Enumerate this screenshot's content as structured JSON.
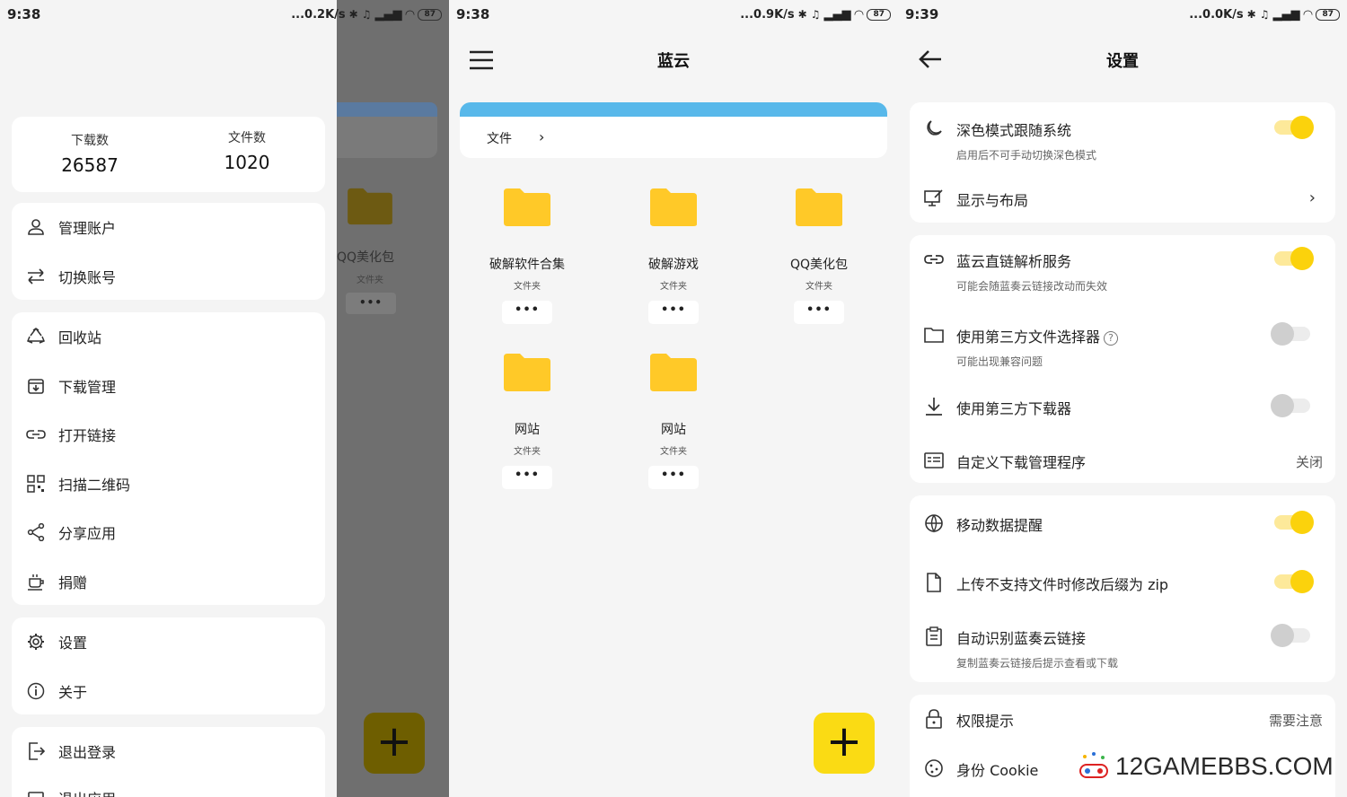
{
  "status_bars": [
    {
      "time": "9:38",
      "net": "...0.2K/s",
      "battery": "87"
    },
    {
      "time": "9:38",
      "net": "...0.9K/s",
      "battery": "87"
    },
    {
      "time": "9:39",
      "net": "...0.0K/s",
      "battery": "87"
    }
  ],
  "drawer": {
    "stats": {
      "downloads_label": "下载数",
      "downloads_value": "26587",
      "files_label": "文件数",
      "files_value": "1020"
    },
    "group1": [
      "管理账户",
      "切换账号"
    ],
    "group2": [
      "回收站",
      "下载管理",
      "打开链接",
      "扫描二维码",
      "分享应用",
      "捐赠"
    ],
    "group3": [
      "设置",
      "关于"
    ],
    "group4": [
      "退出登录",
      "退出应用"
    ],
    "behind": {
      "folder_name": "QQ美化包",
      "folder_sub": "文件夹",
      "more": "•••",
      "fab": "+"
    }
  },
  "files": {
    "title": "蓝云",
    "breadcrumb": "文件",
    "breadcrumb_chevron": "›",
    "items": [
      {
        "name": "破解软件合集",
        "sub": "文件夹",
        "more": "•••"
      },
      {
        "name": "破解游戏",
        "sub": "文件夹",
        "more": "•••"
      },
      {
        "name": "QQ美化包",
        "sub": "文件夹",
        "more": "•••"
      },
      {
        "name": "网站",
        "sub": "文件夹",
        "more": "•••"
      },
      {
        "name": "网站",
        "sub": "文件夹",
        "more": "•••"
      }
    ],
    "fab": "+"
  },
  "settings": {
    "title": "设置",
    "rows": {
      "dark_mode": {
        "title": "深色模式跟随系统",
        "desc": "启用后不可手动切换深色模式",
        "on": true
      },
      "display": {
        "title": "显示与布局",
        "arrow": "›"
      },
      "direct_link": {
        "title": "蓝云直链解析服务",
        "desc": "可能会随蓝奏云链接改动而失效",
        "on": true
      },
      "third_picker": {
        "title": "使用第三方文件选择器",
        "help": "?",
        "desc": "可能出现兼容问题",
        "on": false
      },
      "third_downloader": {
        "title": "使用第三方下载器",
        "on": false
      },
      "custom_dl": {
        "title": "自定义下载管理程序",
        "value": "关闭"
      },
      "mobile_data": {
        "title": "移动数据提醒",
        "on": true
      },
      "upload_zip": {
        "title": "上传不支持文件时修改后缀为 zip",
        "on": true
      },
      "auto_detect": {
        "title": "自动识别蓝奏云链接",
        "desc": "复制蓝奏云链接后提示查看或下载",
        "on": false
      },
      "permission": {
        "title": "权限提示",
        "value": "需要注意"
      },
      "cookie": {
        "title": "身份 Cookie"
      }
    }
  },
  "watermark": "12GAMEBBS.COM",
  "colors": {
    "accent": "#fbd20c",
    "folder": "#ffc928",
    "banner": "#58b8ea"
  }
}
